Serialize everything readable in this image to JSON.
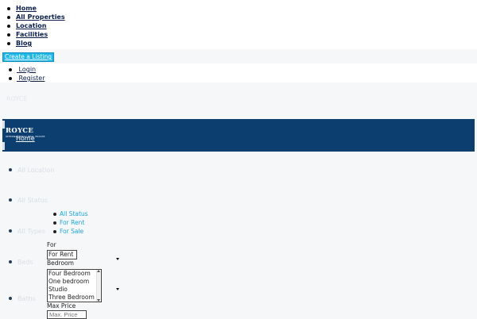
{
  "nav": {
    "items": [
      "Home",
      "All Properties",
      "Location",
      "Facilities",
      "Blog"
    ],
    "create_listing": "Create a Listing"
  },
  "auth": {
    "login": "Login",
    "register": "Register"
  },
  "ghost_brand": "ROYCE",
  "logo": {
    "name": "ROYCE",
    "tagline": "INTERNATIONAL REAL ESTATE"
  },
  "banner_home": "Home",
  "side_labels": [
    "All Location",
    "All Status",
    "All Types",
    "Beds",
    "Baths"
  ],
  "status_options": [
    "All Status",
    "For Rent",
    "For Sale"
  ],
  "filters": {
    "for_label": "For",
    "for_value": "For Rent",
    "bedroom_label": "Bedroom",
    "bedroom_options": [
      "Four Bedroom",
      "One bedroom",
      "Studio",
      "Three Bedroom"
    ],
    "max_price_label": "Max Price",
    "max_price_placeholder": "Max. Price"
  },
  "colors": {
    "banner": "#0c3e6f",
    "accent": "#1fb6e8",
    "status_link": "#1aa6dc"
  }
}
